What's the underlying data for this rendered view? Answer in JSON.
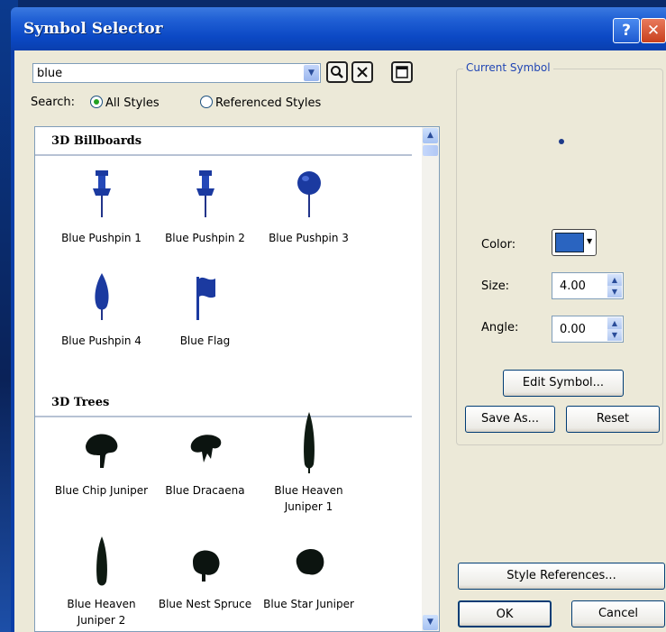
{
  "window": {
    "title": "Symbol Selector",
    "help_glyph": "?",
    "close_glyph": "✕"
  },
  "search": {
    "value": "blue",
    "label": "Search:",
    "options": [
      "All Styles",
      "Referenced Styles"
    ],
    "selected": "All Styles"
  },
  "groups": [
    {
      "name": "3D Billboards",
      "items": [
        {
          "label": "Blue Pushpin 1",
          "icon": "pushpin-1-icon"
        },
        {
          "label": "Blue Pushpin 2",
          "icon": "pushpin-2-icon"
        },
        {
          "label": "Blue Pushpin 3",
          "icon": "pushpin-3-icon"
        },
        {
          "label": "Blue Pushpin 4",
          "icon": "pushpin-4-icon"
        },
        {
          "label": "Blue Flag",
          "icon": "flag-icon"
        }
      ]
    },
    {
      "name": "3D Trees",
      "items": [
        {
          "label": "Blue Chip Juniper",
          "icon": "tree-icon"
        },
        {
          "label": "Blue Dracaena",
          "icon": "tree-icon"
        },
        {
          "label": "Blue Heaven Juniper 1",
          "icon": "tall-tree-icon"
        },
        {
          "label": "Blue Heaven Juniper 2",
          "icon": "tall-tree-icon"
        },
        {
          "label": "Blue Nest Spruce",
          "icon": "tree-icon"
        },
        {
          "label": "Blue Star Juniper",
          "icon": "tree-icon"
        }
      ]
    }
  ],
  "current_symbol": {
    "title": "Current Symbol",
    "color_label": "Color:",
    "color": "#2a64c0",
    "size_label": "Size:",
    "size": "4.00",
    "angle_label": "Angle:",
    "angle": "0.00"
  },
  "buttons": {
    "edit_symbol": "Edit Symbol...",
    "save_as": "Save As...",
    "reset": "Reset",
    "style_references": "Style References...",
    "ok": "OK",
    "cancel": "Cancel"
  }
}
